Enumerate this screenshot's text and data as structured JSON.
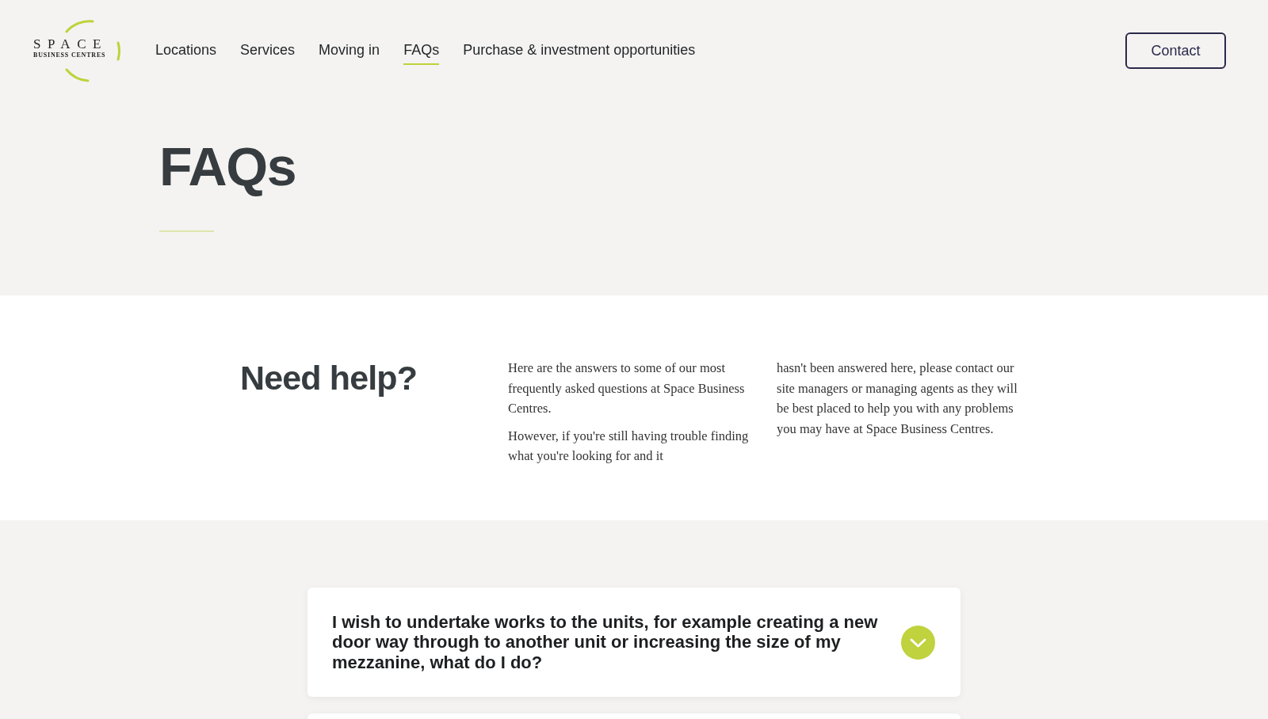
{
  "header": {
    "logo": {
      "wordmark": "SPACE",
      "tagline": "BUSINESS CENTRES"
    },
    "nav": [
      {
        "label": "Locations",
        "selected": false
      },
      {
        "label": "Services",
        "selected": false
      },
      {
        "label": "Moving in",
        "selected": false
      },
      {
        "label": "FAQs",
        "selected": true
      },
      {
        "label": "Purchase & investment opportunities",
        "selected": false
      }
    ],
    "contact_button": "Contact"
  },
  "hero": {
    "title": "FAQs"
  },
  "intro": {
    "heading": "Need help?",
    "column_1": [
      "Here are the answers to some of our most frequently asked questions at Space Business Centres.",
      "However, if you're still having trouble finding what you're looking for and it"
    ],
    "column_2": [
      "hasn't been answered here, please contact our site managers or managing agents as they will be best placed to help you with any problems you may have at Space Business Centres."
    ]
  },
  "faqs": [
    {
      "question": "I wish to undertake works to the units, for example creating a new door way through to another unit or increasing the size of my mezzanine, what do I do?",
      "expanded": false
    }
  ]
}
